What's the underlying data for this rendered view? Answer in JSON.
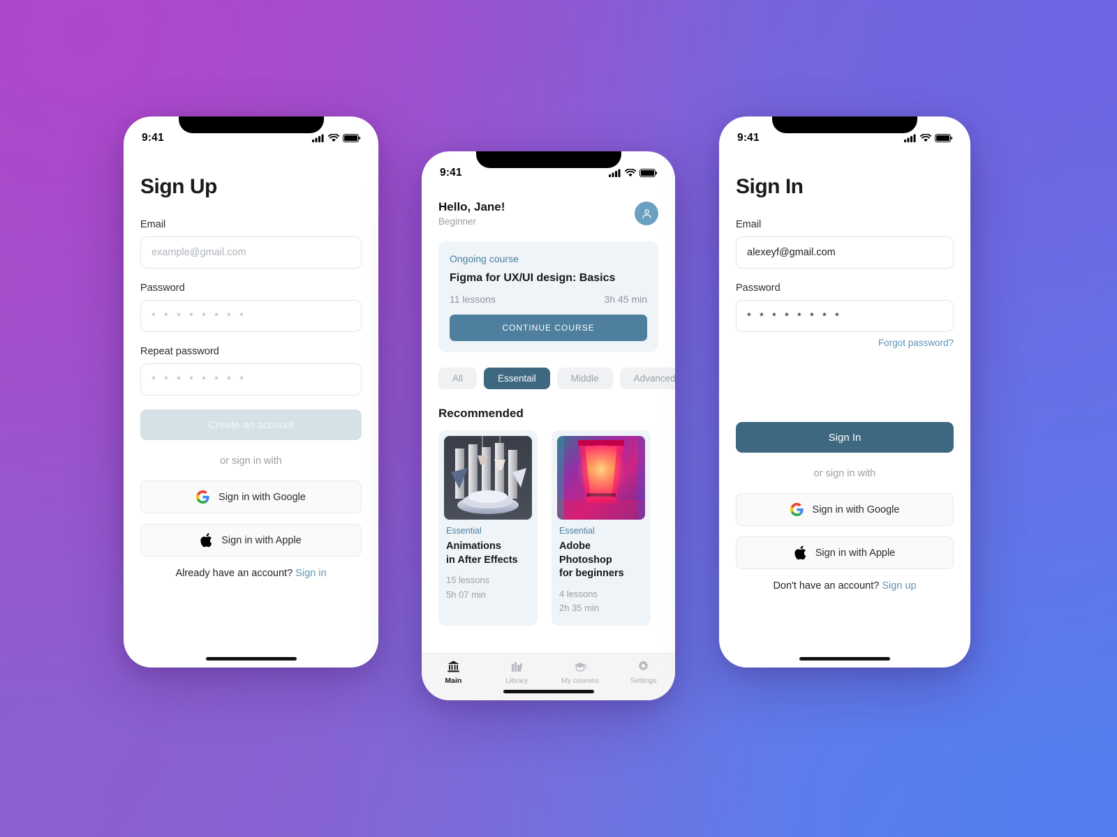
{
  "theme": {
    "accent": "#3E6780",
    "accent_light": "#4E7F9E",
    "link": "#5F93B5",
    "disabled_bg": "#d5e1e6",
    "card_bg": "#eef4f8",
    "avatar_bg": "#6CA0C0",
    "bg_gradient_from": "#A052BE",
    "bg_gradient_to": "#5C80EC"
  },
  "status_bar": {
    "time": "9:41",
    "signal": "signal-icon",
    "wifi": "wifi-icon",
    "battery": "battery-icon"
  },
  "signup": {
    "title": "Sign Up",
    "email": {
      "label": "Email",
      "value": "",
      "placeholder": "example@gmail.com"
    },
    "password": {
      "label": "Password",
      "value": "",
      "placeholder": "* * * * * * * *"
    },
    "repeat_password": {
      "label": "Repeat password",
      "value": "",
      "placeholder": "* * * * * * * *"
    },
    "submit_label": "Create an account",
    "submit_disabled": true,
    "divider_text": "or sign in with",
    "google_label": "Sign in with Google",
    "apple_label": "Sign in with Apple",
    "footer_text": "Already have an account?",
    "footer_link": "Sign in"
  },
  "signin": {
    "title": "Sign In",
    "email": {
      "label": "Email",
      "value": "alexeyf@gmail.com",
      "placeholder": "example@gmail.com"
    },
    "password": {
      "label": "Password",
      "value": "* * * * * * * *",
      "placeholder": "* * * * * * * *"
    },
    "forgot_label": "Forgot password?",
    "submit_label": "Sign In",
    "divider_text": "or sign in with",
    "google_label": "Sign in with Google",
    "apple_label": "Sign in with Apple",
    "footer_text": "Don't have an account?",
    "footer_link": "Sign up"
  },
  "home": {
    "greeting": "Hello, Jane!",
    "level": "Beginner",
    "avatar_icon": "person-icon",
    "ongoing": {
      "eyebrow": "Ongoing course",
      "title": "Figma for UX/UI design: Basics",
      "lessons": "11 lessons",
      "duration": "3h 45 min",
      "button_label": "CONTINUE COURSE"
    },
    "filters": [
      {
        "label": "All",
        "active": false
      },
      {
        "label": "Essentail",
        "active": true
      },
      {
        "label": "Middle",
        "active": false
      },
      {
        "label": "Advanced",
        "active": false
      }
    ],
    "section_title": "Recommended",
    "recommended": [
      {
        "eyebrow": "Essential",
        "title_line1": "Animations",
        "title_line2": "in After Effects",
        "lessons": "15 lessons",
        "duration": "5h 07 min",
        "thumb": "after-effects-thumbnail"
      },
      {
        "eyebrow": "Essential",
        "title_line1": "Adobe Photoshop",
        "title_line2": "for beginners",
        "lessons": "4 lessons",
        "duration": "2h 35 min",
        "thumb": "photoshop-thumbnail"
      }
    ],
    "tabs": [
      {
        "label": "Main",
        "icon": "bank-icon",
        "active": true
      },
      {
        "label": "Library",
        "icon": "books-icon",
        "active": false
      },
      {
        "label": "My courses",
        "icon": "graduation-cap-icon",
        "active": false
      },
      {
        "label": "Settings",
        "icon": "gear-icon",
        "active": false
      }
    ]
  }
}
